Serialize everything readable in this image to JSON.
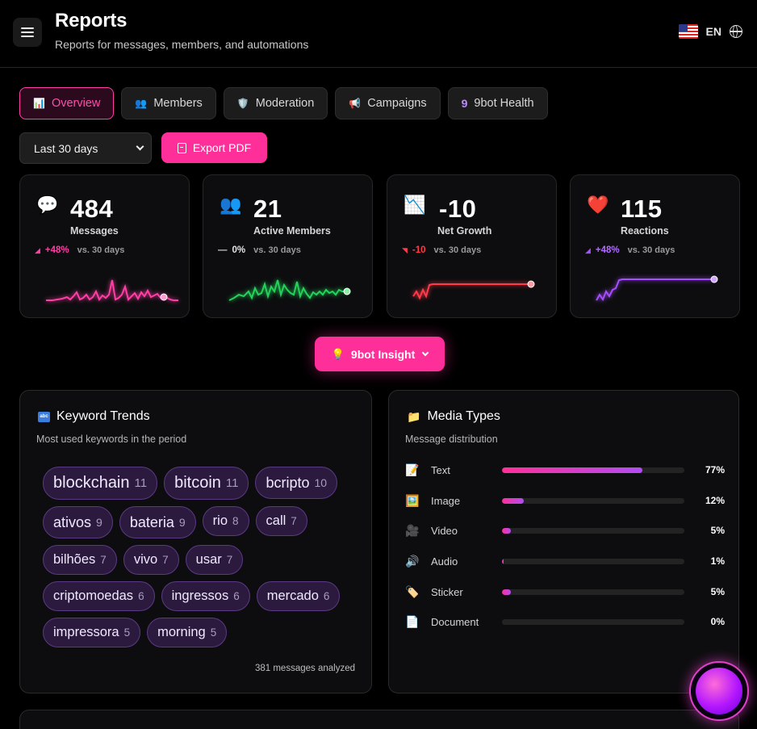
{
  "header": {
    "title": "Reports",
    "subtitle": "Reports for messages, members, and automations",
    "lang_code": "EN"
  },
  "tabs": [
    {
      "label": "Overview",
      "icon": "chart-icon",
      "active": true
    },
    {
      "label": "Members",
      "icon": "people-icon",
      "active": false
    },
    {
      "label": "Moderation",
      "icon": "shield-icon",
      "active": false
    },
    {
      "label": "Campaigns",
      "icon": "megaphone-icon",
      "active": false
    },
    {
      "label": "9bot Health",
      "icon": "bot-icon",
      "active": false
    }
  ],
  "controls": {
    "period_selected": "Last 30 days",
    "export_label": "Export PDF"
  },
  "stats": [
    {
      "value": "484",
      "label": "Messages",
      "delta": "+48%",
      "vs": "vs. 30 days",
      "color": "#ff3ea5",
      "icon": "speech-bubble-icon"
    },
    {
      "value": "21",
      "label": "Active Members",
      "delta": "0%",
      "vs": "vs. 30 days",
      "color": "#22d35a",
      "icon": "people-icon"
    },
    {
      "value": "-10",
      "label": "Net Growth",
      "delta": "-10",
      "vs": "vs. 30 days",
      "color": "#ff3a4a",
      "icon": "chart-down-icon"
    },
    {
      "value": "115",
      "label": "Reactions",
      "delta": "+48%",
      "vs": "vs. 30 days",
      "color": "#a64dff",
      "icon": "heart-icon"
    }
  ],
  "insight": {
    "label": "9bot Insight"
  },
  "keywords": {
    "title": "Keyword Trends",
    "subtitle": "Most used keywords in the period",
    "items": [
      {
        "word": "blockchain",
        "count": "11"
      },
      {
        "word": "bitcoin",
        "count": "11"
      },
      {
        "word": "bcripto",
        "count": "10"
      },
      {
        "word": "ativos",
        "count": "9"
      },
      {
        "word": "bateria",
        "count": "9"
      },
      {
        "word": "rio",
        "count": "8"
      },
      {
        "word": "call",
        "count": "7"
      },
      {
        "word": "bilhões",
        "count": "7"
      },
      {
        "word": "vivo",
        "count": "7"
      },
      {
        "word": "usar",
        "count": "7"
      },
      {
        "word": "criptomoedas",
        "count": "6"
      },
      {
        "word": "ingressos",
        "count": "6"
      },
      {
        "word": "mercado",
        "count": "6"
      },
      {
        "word": "impressora",
        "count": "5"
      },
      {
        "word": "morning",
        "count": "5"
      }
    ],
    "footer": "381 messages analyzed"
  },
  "media": {
    "title": "Media Types",
    "subtitle": "Message distribution",
    "rows": [
      {
        "label": "Text",
        "pct": "77%",
        "value": 77,
        "icon": "memo-icon"
      },
      {
        "label": "Image",
        "pct": "12%",
        "value": 12,
        "icon": "picture-icon"
      },
      {
        "label": "Video",
        "pct": "5%",
        "value": 5,
        "icon": "camera-icon"
      },
      {
        "label": "Audio",
        "pct": "1%",
        "value": 1,
        "icon": "speaker-icon"
      },
      {
        "label": "Sticker",
        "pct": "5%",
        "value": 5,
        "icon": "tag-icon"
      },
      {
        "label": "Document",
        "pct": "0%",
        "value": 0,
        "icon": "page-icon"
      }
    ]
  }
}
